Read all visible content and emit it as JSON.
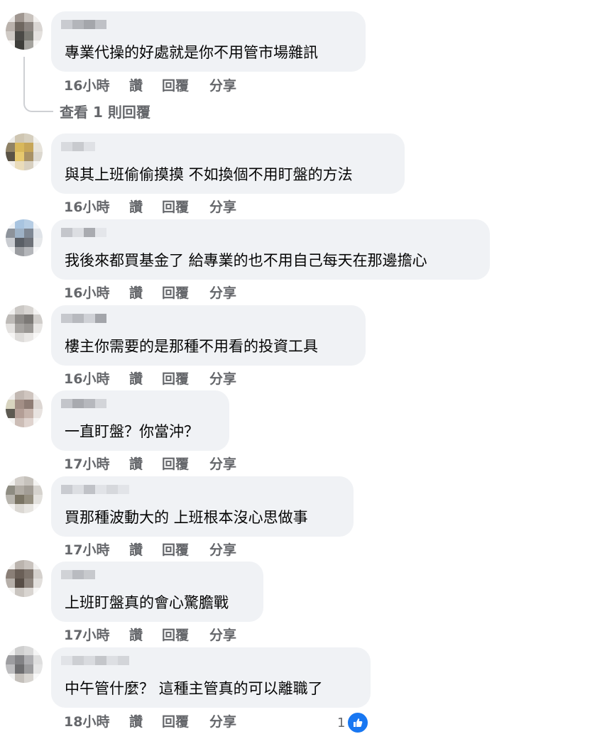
{
  "view_replies": "查看 1 則回覆",
  "actions": {
    "like": "讚",
    "reply": "回覆",
    "share": "分享"
  },
  "comments": [
    {
      "text": "專業代操的好處就是你不用管市場雜訊",
      "time": "16小時"
    },
    {
      "text": "與其上班偷偷摸摸 不如換個不用盯盤的方法",
      "time": "16小時"
    },
    {
      "text": "我後來都買基金了 給專業的也不用自己每天在那邊擔心",
      "time": "16小時"
    },
    {
      "text": "樓主你需要的是那種不用看的投資工具",
      "time": "16小時"
    },
    {
      "text": "一直盯盤？你當沖？",
      "time": "17小時"
    },
    {
      "text": "買那種波動大的 上班根本沒心思做事",
      "time": "17小時"
    },
    {
      "text": "上班盯盤真的會心驚膽戰",
      "time": "17小時"
    },
    {
      "text": "中午管什麼？ 這種主管真的可以離職了",
      "time": "18小時",
      "reaction_count": "1"
    }
  ],
  "colors": {
    "bubble": "#f0f2f5",
    "meta_text": "#65676b",
    "like_badge": "#1877f2",
    "thread_line": "#ced0d4"
  },
  "icons": {
    "reaction": "like-thumb-icon"
  }
}
